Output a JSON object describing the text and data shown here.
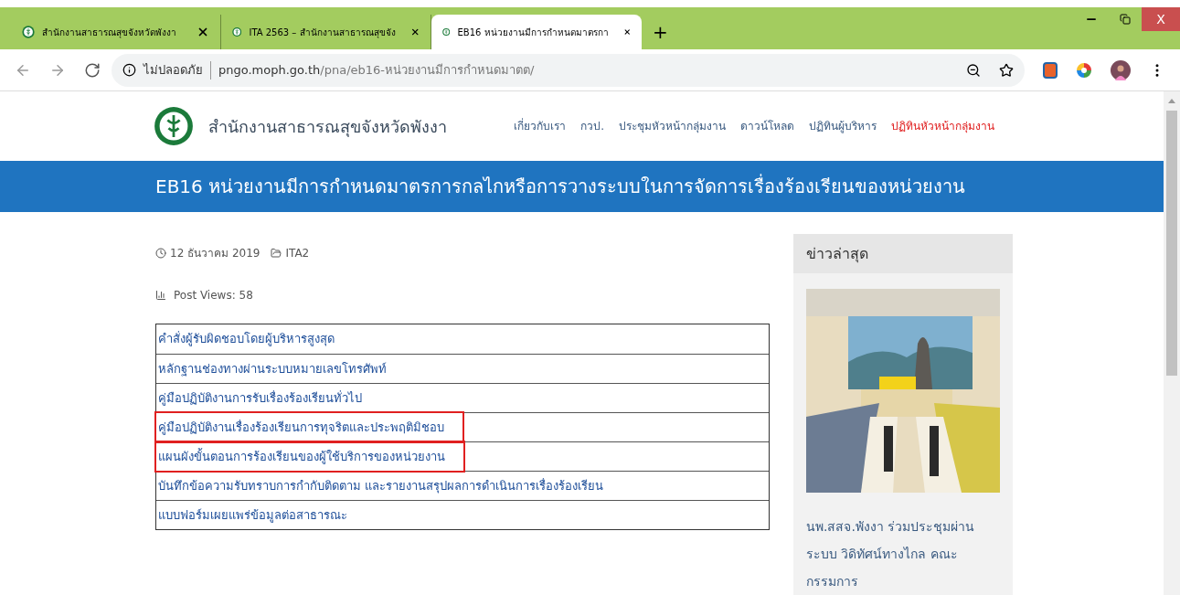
{
  "browser": {
    "tabs": [
      {
        "title": "สำนักงานสาธารณสุขจังหวัดพังงา",
        "selected": false
      },
      {
        "title": "ITA 2563 – สำนักงานสาธารณสุขจัง",
        "selected": false
      },
      {
        "title": "EB16 หน่วยงานมีการกำหนดมาตรกา",
        "selected": true
      }
    ],
    "new_tab": "+",
    "security_label": "ไม่ปลอดภัย",
    "url_host": "pngo.moph.go.th",
    "url_path": "/pna/eb16-หน่วยงานมีการกำหนดมาตต/",
    "close_label": "X"
  },
  "site": {
    "name": "สำนักงานสาธารณสุขจังหวัดพังงา",
    "nav": [
      {
        "label": "เกี่ยวกับเรา",
        "selected": false
      },
      {
        "label": "กวป.",
        "selected": false
      },
      {
        "label": "ประชุมหัวหน้ากลุ่มงาน",
        "selected": false
      },
      {
        "label": "ดาวน์โหลด",
        "selected": false
      },
      {
        "label": "ปฏิทินผู้บริหาร",
        "selected": false
      },
      {
        "label": "ปฏิทินหัวหน้ากลุ่มงาน",
        "selected": true
      }
    ]
  },
  "page_title": "EB16 หน่วยงานมีการกำหนดมาตรการกลไกหรือการวางระบบในการจัดการเรื่องร้องเรียนของหน่วยงาน",
  "post": {
    "date": "12 ธันวาคม 2019",
    "category": "ITA2",
    "views": "Post Views: 58"
  },
  "documents": [
    {
      "title": "คำสั่งผู้รับผิดชอบโดยผู้บริหารสูงสุด",
      "highlighted": false
    },
    {
      "title": "หลักฐานช่องทางผ่านระบบหมายเลขโทรศัพท์",
      "highlighted": false
    },
    {
      "title": "คู่มือปฏิบัติงานการรับเรื่องร้องเรียนทั่วไป",
      "highlighted": false
    },
    {
      "title": "คู่มือปฏิบัติงานเรื่องร้องเรียนการทุจริตและประพฤติมิชอบ",
      "highlighted": true
    },
    {
      "title": "แผนผังขั้นตอนการร้องเรียนของผู้ใช้บริการของหน่วยงาน",
      "highlighted": true
    },
    {
      "title": "บันทึกข้อความรับทราบการกำกับติดตาม และรายงานสรุปผลการดำเนินการเรื่องร้องเรียน",
      "highlighted": false
    },
    {
      "title": "แบบฟอร์มเผยแพร่ข้อมูลต่อสาธารณะ",
      "highlighted": false
    }
  ],
  "sidebar": {
    "heading": "ข่าวล่าสุด",
    "news": [
      {
        "kind": "picture",
        "title": "นพ.สสจ.พังงา ร่วมประชุมผ่านระบบ วิดิทัศน์ทางไกล คณะกรรมการ"
      }
    ]
  }
}
